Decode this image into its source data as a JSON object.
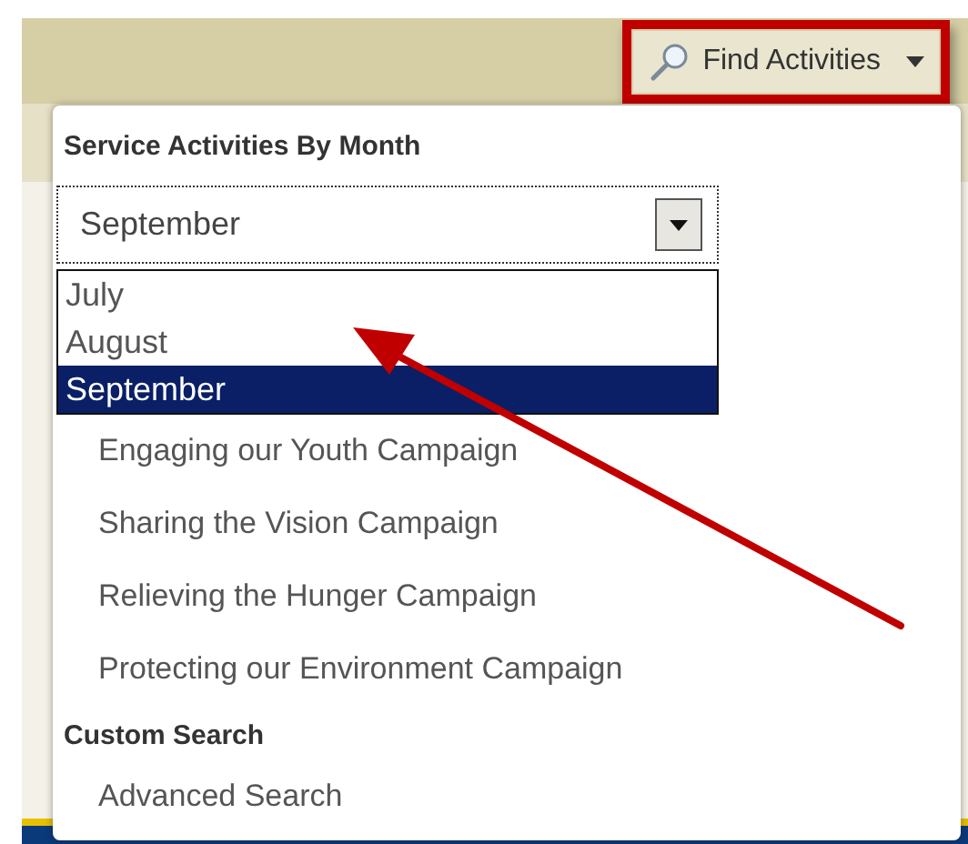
{
  "toolbar": {
    "find_button": {
      "label": "Find Activities",
      "highlighted": true
    }
  },
  "menu": {
    "sections": [
      {
        "heading": "Service Activities By Month",
        "select": {
          "value": "September",
          "expanded": true,
          "options": [
            {
              "label": "July",
              "selected": false
            },
            {
              "label": "August",
              "selected": false
            },
            {
              "label": "September",
              "selected": true
            }
          ]
        },
        "items": [
          "Engaging our Youth Campaign",
          "Sharing the Vision Campaign",
          "Relieving the Hunger Campaign",
          "Protecting our Environment Campaign"
        ]
      },
      {
        "heading": "Custom Search",
        "items": [
          "Advanced Search"
        ]
      }
    ]
  }
}
